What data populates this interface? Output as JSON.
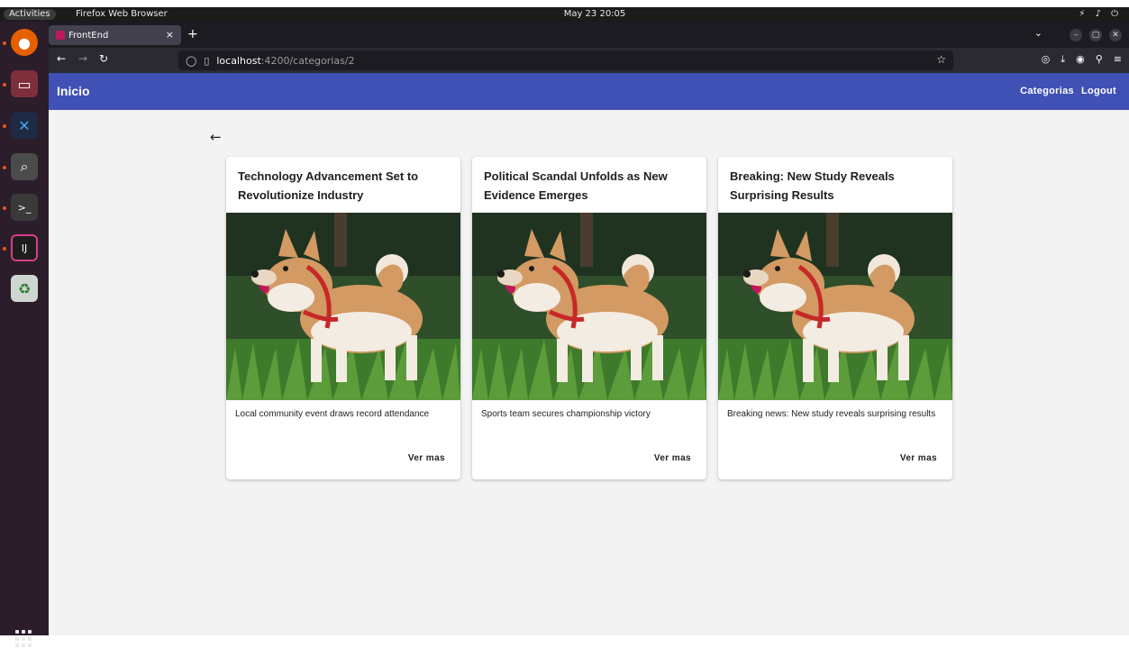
{
  "system": {
    "activities": "Activities",
    "app_name": "Firefox Web Browser",
    "clock": "May 23  20:05"
  },
  "browser": {
    "tab_title": "FrontEnd",
    "url_host": "localhost",
    "url_rest": ":4200/categorias/2"
  },
  "app": {
    "brand": "Inicio",
    "menu": [
      "Categorias",
      "Logout"
    ],
    "back_icon": "arrow-left-icon",
    "accent_color": "#3f51b5",
    "cards": [
      {
        "title": "Technology Advancement Set to Revolutionize Industry",
        "description": "Local community event draws record attendance",
        "action": "Ver mas"
      },
      {
        "title": "Political Scandal Unfolds as New Evidence Emerges",
        "description": "Sports team secures championship victory",
        "action": "Ver mas"
      },
      {
        "title": "Breaking: New Study Reveals Surprising Results",
        "description": "Breaking news: New study reveals surprising results",
        "action": "Ver mas"
      }
    ]
  }
}
